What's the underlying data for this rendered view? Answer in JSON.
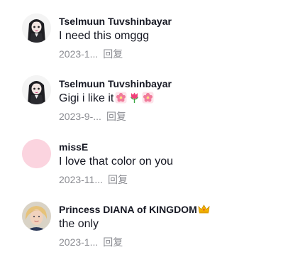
{
  "comments": [
    {
      "author": "Tselmuun Tuvshinbayar",
      "text": "I need this omggg",
      "date": "2023-1...",
      "reply_label": "回复",
      "avatar": "anime-character-avatar"
    },
    {
      "author": "Tselmuun Tuvshinbayar",
      "text": "Gigi i like it",
      "emojis": [
        "cherry-blossom-emoji",
        "tulip-emoji",
        "cherry-blossom-emoji"
      ],
      "date": "2023-9-...",
      "reply_label": "回复",
      "avatar": "anime-character-avatar"
    },
    {
      "author": "missE",
      "text": "I love that color on you",
      "date": "2023-11...",
      "reply_label": "回复",
      "avatar": "pink-circle-avatar"
    },
    {
      "author": "Princess DIANA of KINGDOM",
      "author_badge": "crown-emoji",
      "text": "the only",
      "date": "2023-1...",
      "reply_label": "回复",
      "avatar": "portrait-photo-avatar"
    }
  ],
  "colors": {
    "text": "#161823",
    "meta": "#8a8b91",
    "pink_avatar": "#fbd4df"
  }
}
